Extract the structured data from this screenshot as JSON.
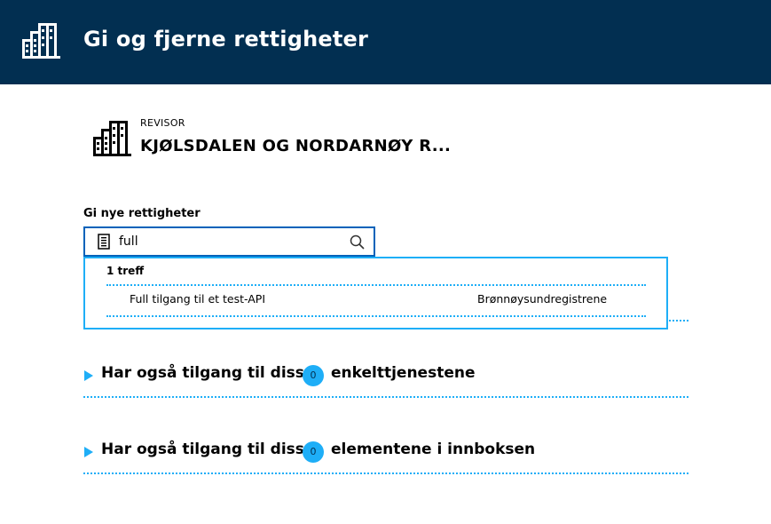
{
  "header": {
    "title": "Gi og fjerne rettigheter",
    "background_color": "#022f51"
  },
  "organization": {
    "role": "REVISOR",
    "name": "KJØLSDALEN OG NORDARNØY R..."
  },
  "rights": {
    "label": "Gi nye rettigheter",
    "search_value": "full",
    "search_placeholder": ""
  },
  "search_results": {
    "count_label": "1 treff",
    "items": [
      {
        "name": "Full tilgang til et test-API",
        "owner": "Brønnøysundregistrene"
      }
    ]
  },
  "expanders": [
    {
      "prefix": "Har også tilgang til disse",
      "count": "0",
      "suffix": "enkelttjenestene"
    },
    {
      "prefix": "Har også tilgang til disse",
      "count": "0",
      "suffix": "elementene i innboksen"
    }
  ],
  "colors": {
    "accent": "#1eaef7",
    "focus_border": "#0062ba",
    "header": "#022f51"
  },
  "icons": {
    "logo": "building-icon",
    "search": "search-icon",
    "document": "document-icon",
    "expand": "caret-right-icon"
  }
}
